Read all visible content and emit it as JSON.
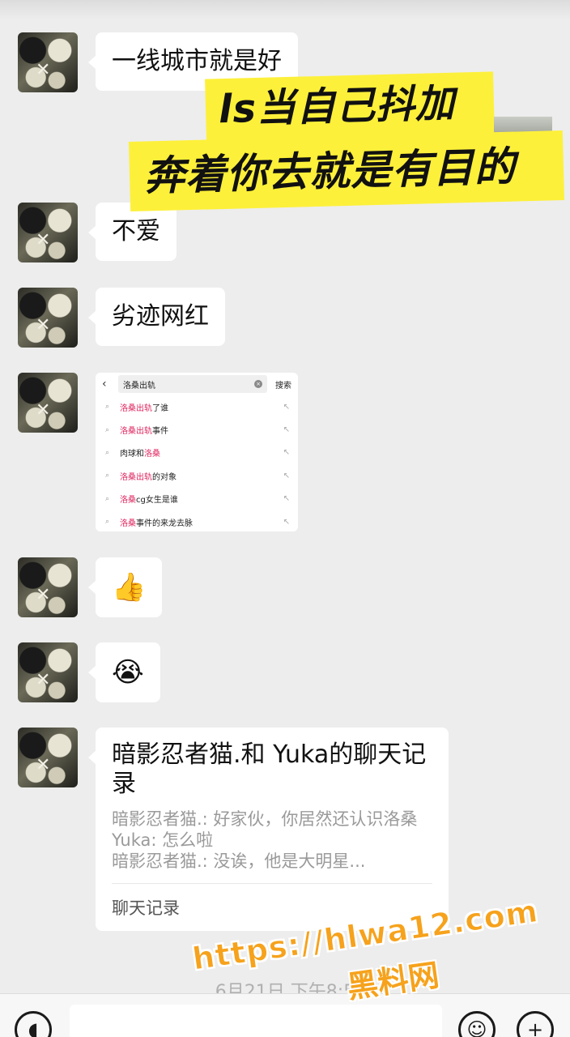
{
  "messages": [
    {
      "text": "一线城市就是好"
    },
    {
      "text": "不爱"
    },
    {
      "text": "劣迹网红"
    }
  ],
  "captions": {
    "line1": "ls当自己抖加",
    "line2": "奔着你去就是有目的"
  },
  "search_shot": {
    "query": "洛桑出轨",
    "search_button": "搜索",
    "suggestions": [
      {
        "hl": "洛桑出轨",
        "rest": "了谁"
      },
      {
        "hl": "洛桑出轨",
        "rest": "事件"
      },
      {
        "pre": "肉球和",
        "hl": "洛桑",
        "rest": ""
      },
      {
        "hl": "洛桑出轨",
        "rest": "的对象"
      },
      {
        "hl": "洛桑",
        "rest": "cg女生是谁"
      },
      {
        "hl": "洛桑",
        "rest": "事件的来龙去脉"
      }
    ]
  },
  "emojis": {
    "thumbs_up": "👍",
    "laugh_cry": "😭"
  },
  "chat_record": {
    "title": "暗影忍者猫.和 Yuka的聊天记录",
    "lines": [
      "暗影忍者猫.: 好家伙，你居然还认识洛桑",
      "Yuka: 怎么啦",
      "暗影忍者猫.: 没诶，他是大明星..."
    ],
    "footer": "聊天记录"
  },
  "timestamp": "6月21日 下午8:5",
  "watermark": {
    "url": "https://hlwa12.com",
    "name": "黑料网"
  },
  "input_bar": {
    "voice_icon": "voice-icon",
    "emoji_icon": "emoji-icon",
    "plus_icon": "plus-icon"
  }
}
